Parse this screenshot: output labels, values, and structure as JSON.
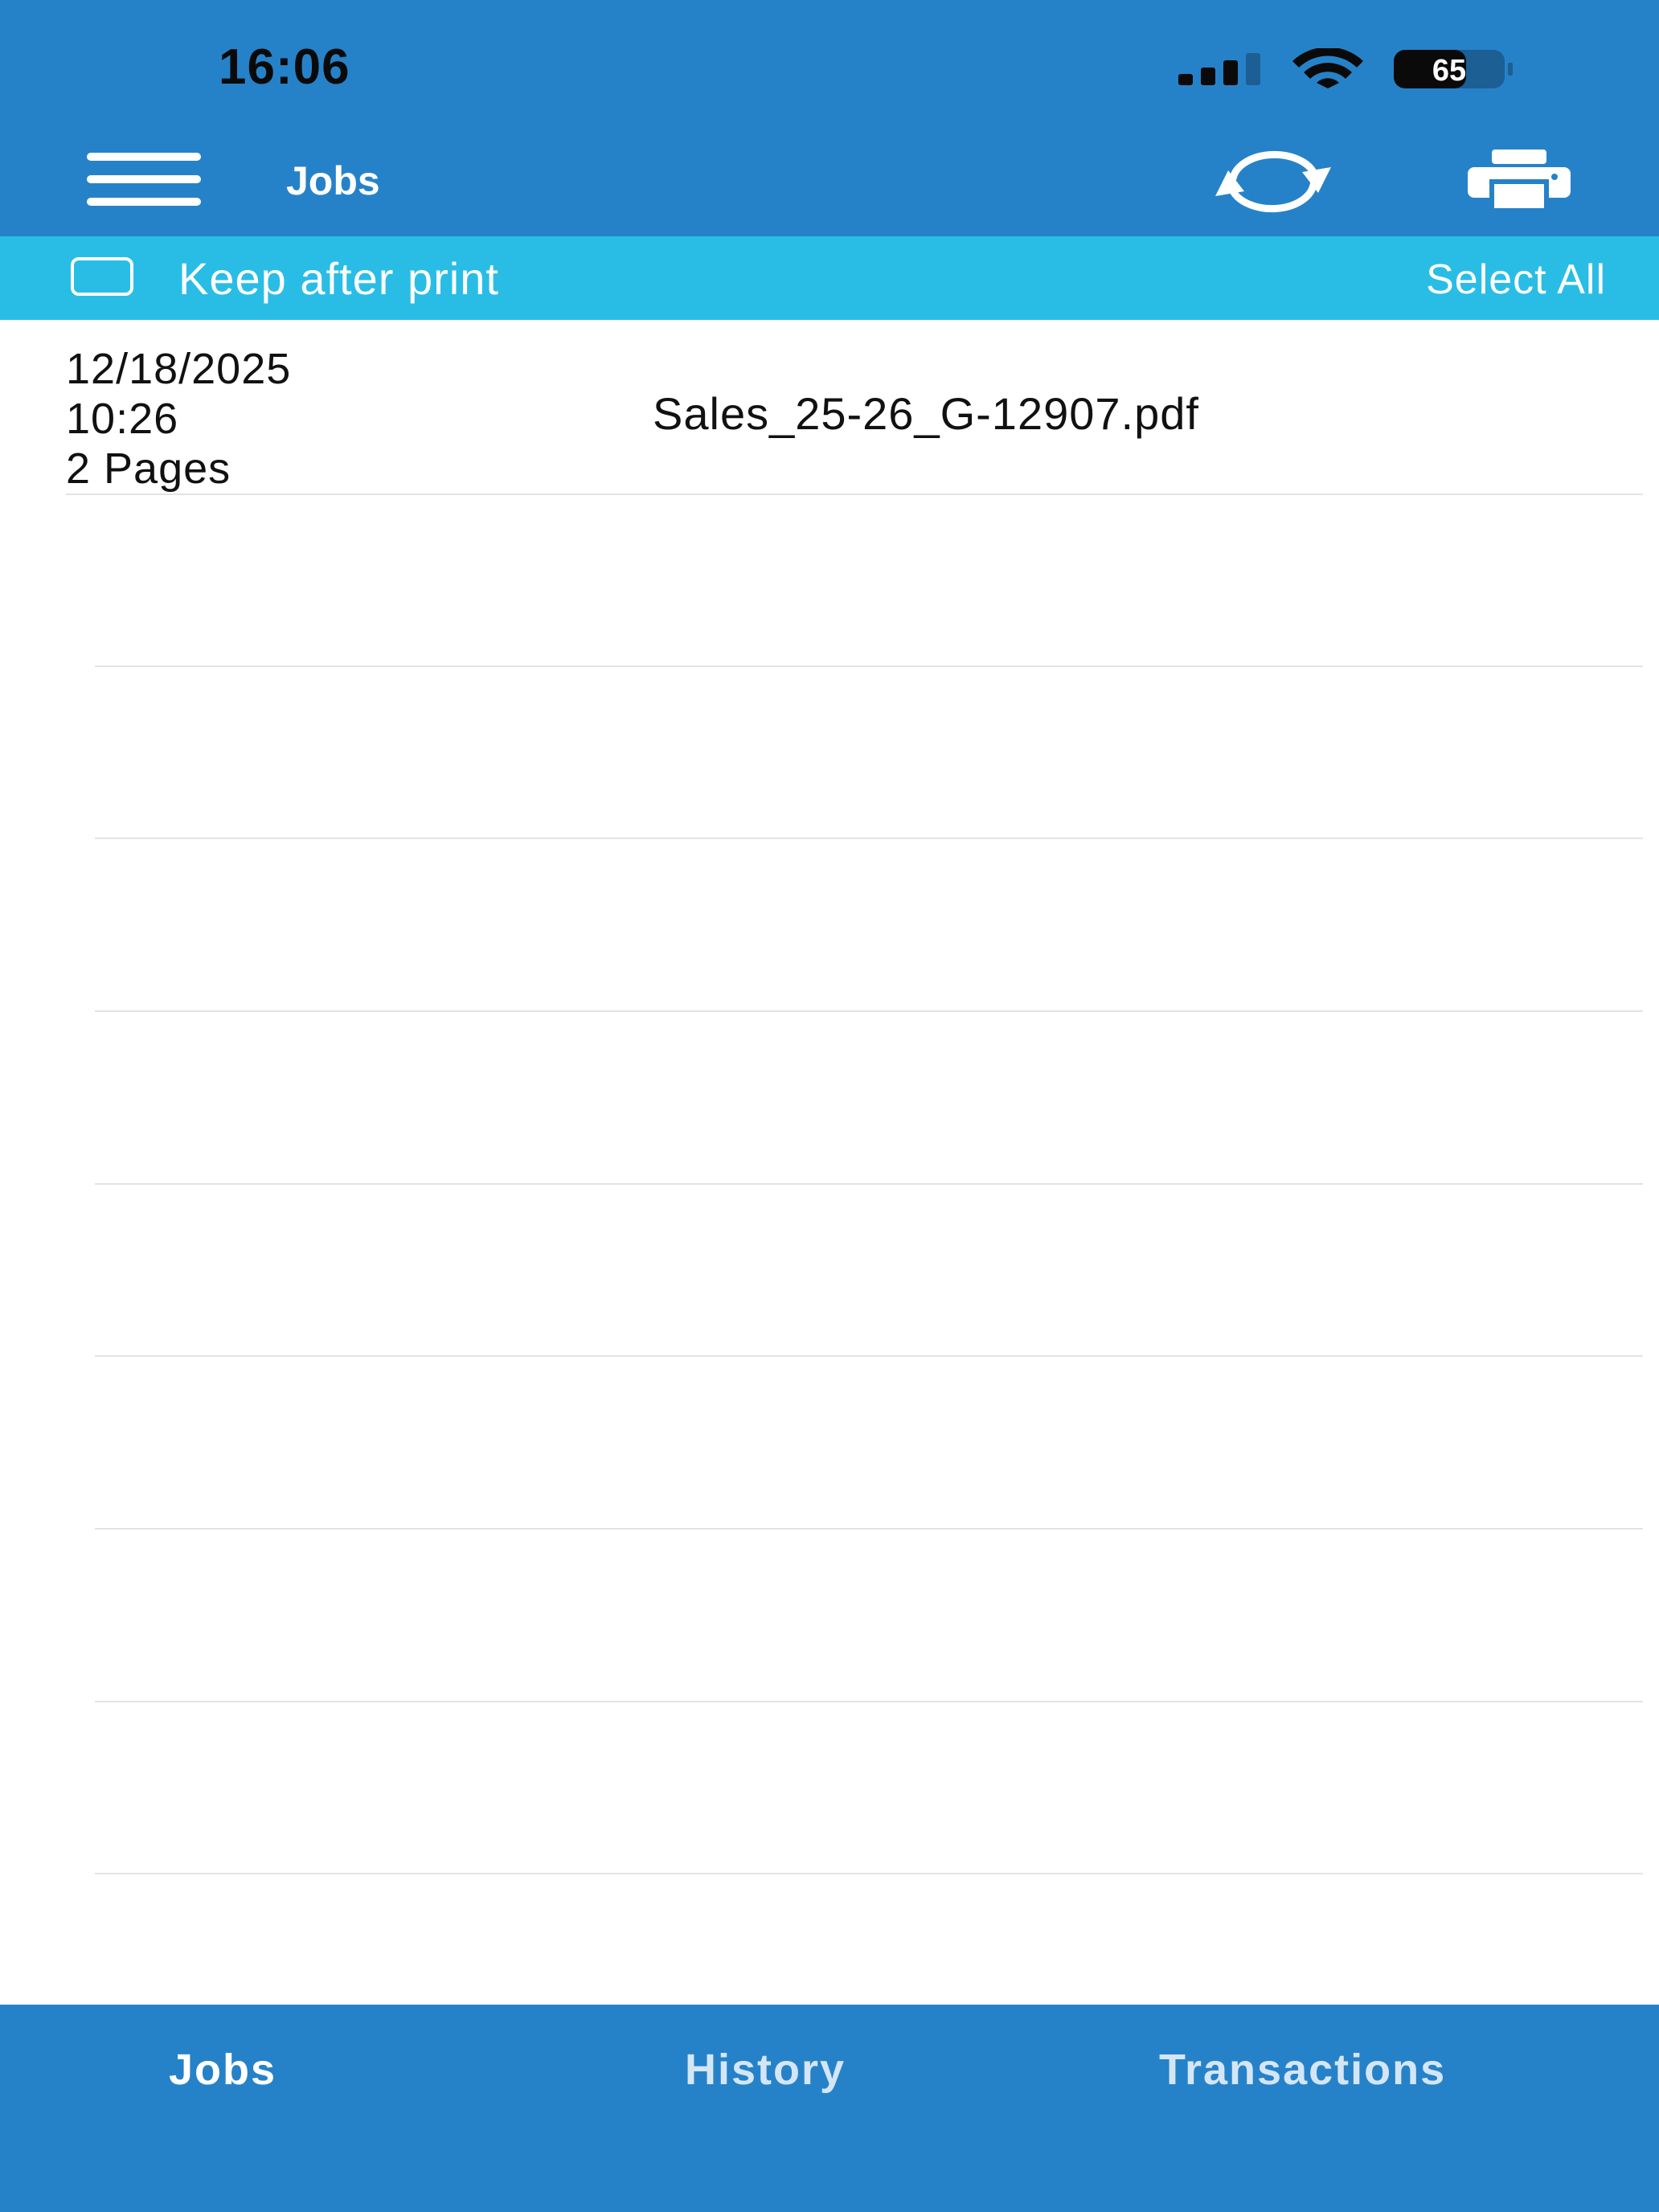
{
  "status_bar": {
    "time": "16:06",
    "battery_level": "65"
  },
  "header": {
    "title": "Jobs",
    "icons": [
      "menu-icon",
      "refresh-icon",
      "printer-icon"
    ]
  },
  "toolbar": {
    "keep_after_print_label": "Keep after print",
    "keep_after_print_checked": false,
    "select_all_label": "Select All"
  },
  "jobs": [
    {
      "date": "12/18/2025",
      "time": "10:26",
      "pages": "2 Pages",
      "filename": "Sales_25-26_G-12907.pdf"
    }
  ],
  "tabs": [
    {
      "label": "Jobs",
      "active": true
    },
    {
      "label": "History",
      "active": false
    },
    {
      "label": "Transactions",
      "active": false
    }
  ],
  "colors": {
    "primary": "#2682C8",
    "toolbar": "#29BDE6",
    "text": "#111111",
    "divider": "#E3E3E3"
  }
}
